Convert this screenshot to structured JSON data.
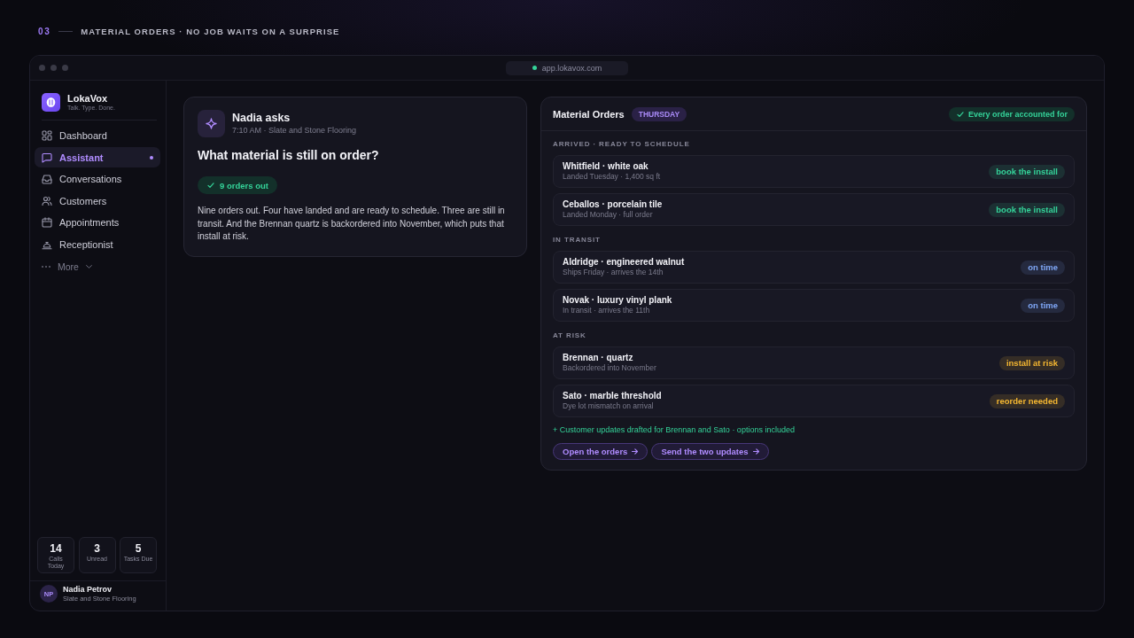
{
  "header": {
    "number": "03",
    "title": "MATERIAL ORDERS · NO JOB WAITS ON A SURPRISE"
  },
  "browser": {
    "url": "app.lokavox.com"
  },
  "sidebar": {
    "brand": {
      "name": "LokaVox",
      "tagline": "Talk. Type. Done."
    },
    "items": [
      {
        "label": "Dashboard",
        "selected": false,
        "notify": false
      },
      {
        "label": "Assistant",
        "selected": true,
        "notify": true
      },
      {
        "label": "Conversations",
        "selected": false,
        "notify": false
      },
      {
        "label": "Customers",
        "selected": false,
        "notify": false
      },
      {
        "label": "Appointments",
        "selected": false,
        "notify": false
      },
      {
        "label": "Receptionist",
        "selected": false,
        "notify": false
      }
    ],
    "more": "More",
    "stats": [
      {
        "value": "14",
        "label": "Calls Today"
      },
      {
        "value": "3",
        "label": "Unread"
      },
      {
        "value": "5",
        "label": "Tasks Due"
      }
    ],
    "user": {
      "initials": "NP",
      "name": "Nadia Petrov",
      "company": "Slate and Stone Flooring"
    }
  },
  "question_card": {
    "asker": "Nadia asks",
    "meta": "7:10 AM · Slate and Stone Flooring",
    "question": "What material is still on order?",
    "summary": "9 orders out",
    "answer": "Nine orders out. Four have landed and are ready to schedule. Three are still in transit. And the Brennan quartz is backordered into November, which puts that install at risk."
  },
  "orders_panel": {
    "title": "Material Orders",
    "day": "THURSDAY",
    "status": "Every order accounted for",
    "sections": [
      {
        "label": "ARRIVED · READY TO SCHEDULE",
        "orders": [
          {
            "title": "Whitfield · white oak",
            "detail": "Landed Tuesday · 1,400 sq ft",
            "badge": "book the install",
            "color": "#34d399"
          },
          {
            "title": "Ceballos · porcelain tile",
            "detail": "Landed Monday · full order",
            "badge": "book the install",
            "color": "#34d399"
          }
        ]
      },
      {
        "label": "IN TRANSIT",
        "orders": [
          {
            "title": "Aldridge · engineered walnut",
            "detail": "Ships Friday · arrives the 14th",
            "badge": "on time",
            "color": "#7ea6f5"
          },
          {
            "title": "Novak · luxury vinyl plank",
            "detail": "In transit · arrives the 11th",
            "badge": "on time",
            "color": "#7ea6f5"
          }
        ]
      },
      {
        "label": "AT RISK",
        "orders": [
          {
            "title": "Brennan · quartz",
            "detail": "Backordered into November",
            "badge": "install at risk",
            "color": "#f5b731"
          },
          {
            "title": "Sato · marble threshold",
            "detail": "Dye lot mismatch on arrival",
            "badge": "reorder needed",
            "color": "#f5b731"
          }
        ]
      }
    ],
    "note": "+ Customer updates drafted for Brennan and Sato · options included",
    "actions": [
      {
        "label": "Open the orders"
      },
      {
        "label": "Send the two updates"
      }
    ]
  }
}
